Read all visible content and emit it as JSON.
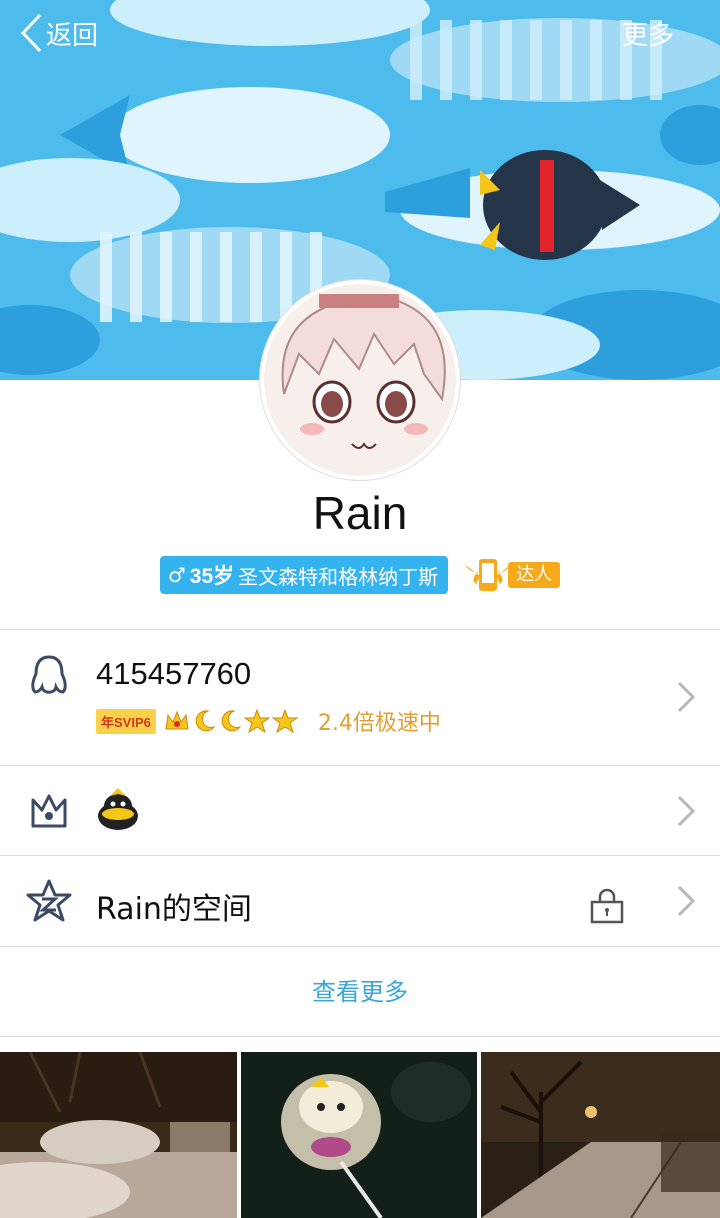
{
  "nav": {
    "back_label": "返回",
    "more_label": "更多"
  },
  "profile": {
    "nickname": "Rain",
    "gender_symbol": "♂",
    "age": "35岁",
    "location": "圣文森特和格林纳丁斯",
    "daren_label": "达人"
  },
  "account": {
    "qq_number": "415457760",
    "svip_badge": "年SVIP6",
    "speed_text": "2.4倍极速中"
  },
  "zone": {
    "label": "Rain的空间"
  },
  "see_more_label": "查看更多",
  "colors": {
    "banner_blue": "#4dbcec",
    "tag_blue": "#35b3ee",
    "speed_orange": "#e0a030",
    "link_blue": "#3aa6d8",
    "icon_gray": "#3c4a66"
  },
  "icons": [
    "back-chevron-icon",
    "penguin-outline-icon",
    "crown-icon",
    "penguin-pet-icon",
    "star-z-icon",
    "lock-icon",
    "chevron-right-icon"
  ]
}
